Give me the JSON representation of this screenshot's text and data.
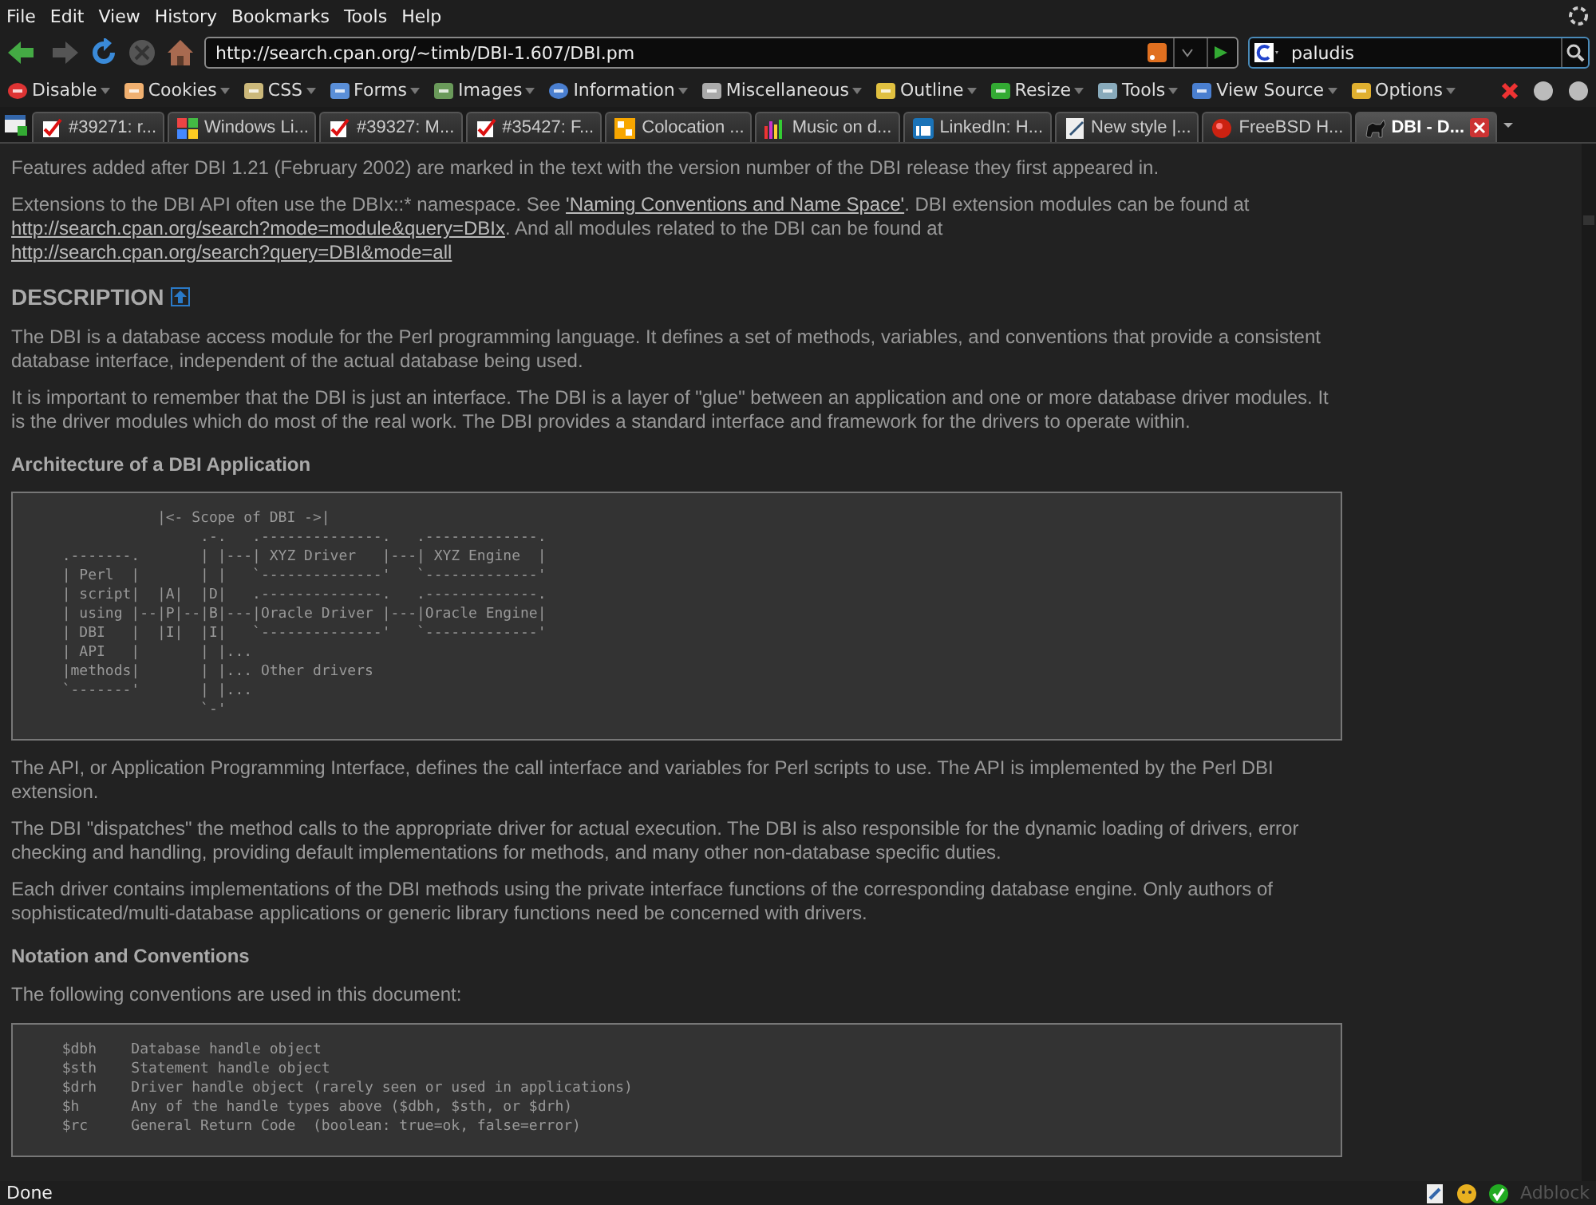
{
  "menu": [
    "File",
    "Edit",
    "View",
    "History",
    "Bookmarks",
    "Tools",
    "Help"
  ],
  "address": {
    "value": "http://search.cpan.org/~timb/DBI-1.607/DBI.pm"
  },
  "search": {
    "value": "paludis"
  },
  "devtoolbar": [
    "Disable",
    "Cookies",
    "CSS",
    "Forms",
    "Images",
    "Information",
    "Miscellaneous",
    "Outline",
    "Resize",
    "Tools",
    "View Source",
    "Options"
  ],
  "tabs": [
    {
      "label": "#39271: r...",
      "selected": false
    },
    {
      "label": "Windows Li...",
      "selected": false
    },
    {
      "label": "#39327: M...",
      "selected": false
    },
    {
      "label": "#35427: F...",
      "selected": false
    },
    {
      "label": "Colocation ...",
      "selected": false
    },
    {
      "label": "Music on d...",
      "selected": false
    },
    {
      "label": "LinkedIn: H...",
      "selected": false
    },
    {
      "label": "New style |...",
      "selected": false
    },
    {
      "label": "FreeBSD H...",
      "selected": false
    },
    {
      "label": "DBI - D...",
      "selected": true
    }
  ],
  "content": [
    {
      "kind": "para",
      "parts": [
        {
          "text": "Features added after DBI 1.21 (February 2002) are marked in the text with the version number of the DBI release they first appeared in."
        }
      ]
    },
    {
      "kind": "para",
      "parts": [
        {
          "text": "Extensions to the DBI API often use the DBIx::* namespace. See "
        },
        {
          "link": "'Naming Conventions and Name Space'"
        },
        {
          "text": ". DBI extension modules can be found at "
        },
        {
          "link": "http://search.cpan.org/search?mode=module&query=DBIx"
        },
        {
          "text": ". And all modules related to the DBI can be found at "
        },
        {
          "link": "http://search.cpan.org/search?query=DBI&mode=all"
        }
      ]
    },
    {
      "kind": "heading",
      "text": "DESCRIPTION"
    },
    {
      "kind": "para",
      "parts": [
        {
          "text": "The DBI is a database access module for the Perl programming language. It defines a set of methods, variables, and conventions that provide a consistent database interface, independent of the actual database being used."
        }
      ]
    },
    {
      "kind": "para",
      "parts": [
        {
          "text": "It is important to remember that the DBI is just an interface. The DBI is a layer of \"glue\" between an application and one or more database driver modules. It is the driver modules which do most of the real work. The DBI provides a standard interface and framework for the drivers to operate within."
        }
      ]
    },
    {
      "kind": "subheading",
      "text": "Architecture of a DBI Application"
    },
    {
      "kind": "code",
      "text": "             |<- Scope of DBI ->|\n                  .-.   .--------------.   .-------------.\n  .-------.       | |---| XYZ Driver   |---| XYZ Engine  |\n  | Perl  |       | |   `--------------'   `-------------'\n  | script|  |A|  |D|   .--------------.   .-------------.\n  | using |--|P|--|B|---|Oracle Driver |---|Oracle Engine|\n  | DBI   |  |I|  |I|   `--------------'   `-------------'\n  | API   |       | |...\n  |methods|       | |... Other drivers\n  `-------'       | |...\n                  `-'"
    },
    {
      "kind": "para",
      "parts": [
        {
          "text": "The API, or Application Programming Interface, defines the call interface and variables for Perl scripts to use. The API is implemented by the Perl DBI extension."
        }
      ]
    },
    {
      "kind": "para",
      "parts": [
        {
          "text": "The DBI \"dispatches\" the method calls to the appropriate driver for actual execution. The DBI is also responsible for the dynamic loading of drivers, error checking and handling, providing default implementations for methods, and many other non-database specific duties."
        }
      ]
    },
    {
      "kind": "para",
      "parts": [
        {
          "text": "Each driver contains implementations of the DBI methods using the private interface functions of the corresponding database engine. Only authors of sophisticated/multi-database applications or generic library functions need be concerned with drivers."
        }
      ]
    },
    {
      "kind": "subheading",
      "text": "Notation and Conventions"
    },
    {
      "kind": "para",
      "parts": [
        {
          "text": "The following conventions are used in this document:"
        }
      ]
    },
    {
      "kind": "code",
      "text": "  $dbh    Database handle object\n  $sth    Statement handle object\n  $drh    Driver handle object (rarely seen or used in applications)\n  $h      Any of the handle types above ($dbh, $sth, or $drh)\n  $rc     General Return Code  (boolean: true=ok, false=error)"
    }
  ],
  "status": {
    "text": "Done",
    "adblock": "Adblock"
  }
}
